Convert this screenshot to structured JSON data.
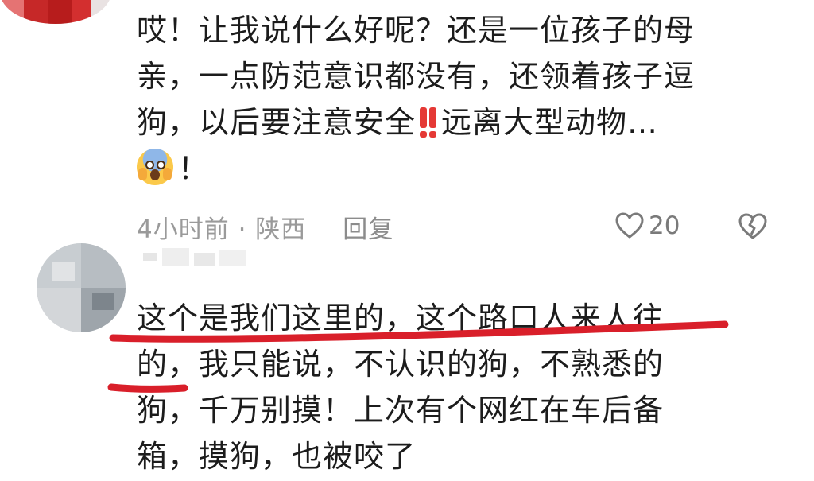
{
  "comment1": {
    "lines": [
      "哎！让我说什么好呢？还是一位孩子的母",
      "亲，一点防范意识都没有，还领着孩子逗",
      "狗，以后要注意安全",
      "远离大型动物…",
      "！"
    ],
    "meta": {
      "time": "4小时前 · 陕西",
      "reply_label": "回复"
    },
    "likes": "20"
  },
  "comment2": {
    "lines": [
      "这个是我们这里的，这个路口人来人往",
      "的，我只能说，不认识的狗，不熟悉的",
      "狗，千万别摸！上次有个网红在车后备",
      "箱，摸狗，也被咬了"
    ]
  },
  "colors": {
    "underline": "#d91f2a",
    "meta_gray": "#9a9a9a",
    "exclaim_red": "#e53935"
  },
  "icons": {
    "like": "heart-outline-icon",
    "dislike": "broken-heart-icon",
    "exclaim": "double-exclamation-emoji",
    "scream": "screaming-face-emoji"
  }
}
